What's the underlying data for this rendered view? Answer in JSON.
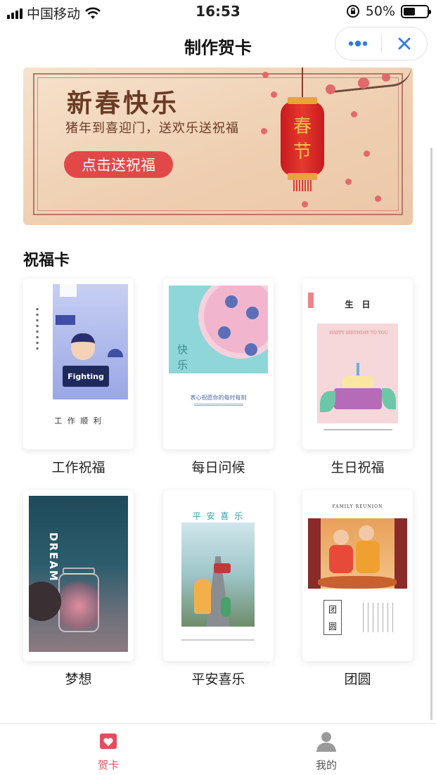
{
  "status_bar": {
    "carrier": "中国移动",
    "time": "16:53",
    "battery": "50%",
    "battery_level": 0.5
  },
  "nav": {
    "title": "制作贺卡"
  },
  "banner": {
    "title": "新春快乐",
    "subtitle": "猪年到喜迎门，送欢乐送祝福",
    "button_label": "点击送祝福",
    "lantern_text_1": "春",
    "lantern_text_2": "节"
  },
  "section": {
    "title": "祝福卡"
  },
  "cards": [
    {
      "label": "工作祝福",
      "art_text": "Fighting",
      "caption": "工 作 顺 利"
    },
    {
      "label": "每日问候",
      "art_text": "快",
      "art_text_2": "乐",
      "caption": "表心祝愿你的每时每刻"
    },
    {
      "label": "生日祝福",
      "art_text": "生　日",
      "art_sub": "HAPPY BIRTHDAY TO YOU"
    },
    {
      "label": "梦想",
      "art_text": "DREAM"
    },
    {
      "label": "平安喜乐",
      "art_text": "平 安 喜 乐"
    },
    {
      "label": "团圆",
      "art_text": "FAMILY REUNION",
      "art_text_2": "团",
      "art_text_3": "圆"
    }
  ],
  "tab_bar": {
    "items": [
      {
        "label": "贺卡",
        "icon": "card-heart-icon",
        "active": true
      },
      {
        "label": "我的",
        "icon": "user-icon",
        "active": false
      }
    ]
  },
  "colors": {
    "accent": "#e34848",
    "tab_active": "#e84a5f",
    "tab_inactive": "#555555",
    "capsule_icon": "#2f7be8"
  }
}
